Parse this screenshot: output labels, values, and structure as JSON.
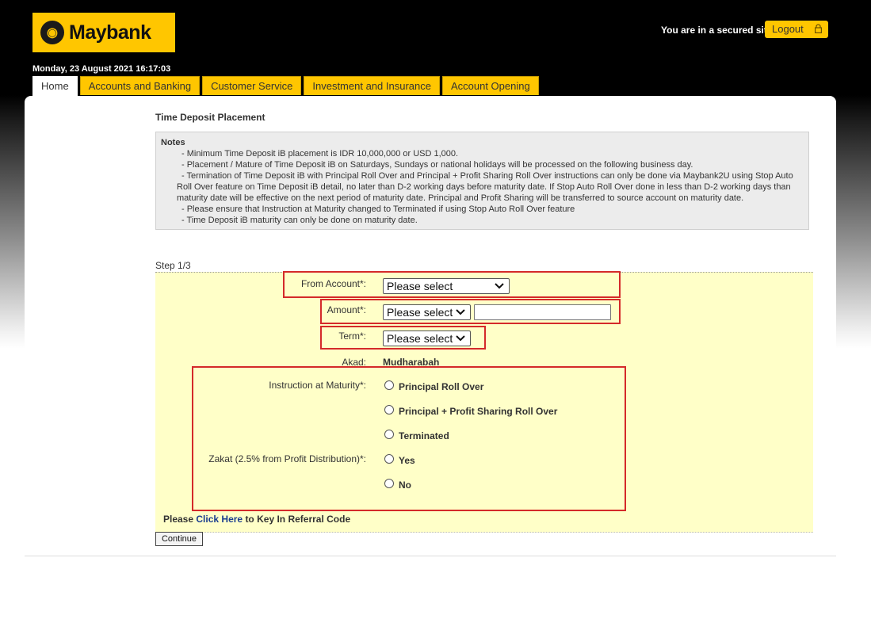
{
  "header": {
    "logo_text": "Maybank",
    "secure_text": "You are in a secured site",
    "logout_label": "Logout",
    "datetime": "Monday, 23 August 2021 16:17:03"
  },
  "tabs": [
    {
      "label": "Home",
      "active": true
    },
    {
      "label": "Accounts and Banking",
      "active": false
    },
    {
      "label": "Customer Service",
      "active": false
    },
    {
      "label": "Investment and Insurance",
      "active": false
    },
    {
      "label": "Account Opening",
      "active": false
    }
  ],
  "page": {
    "title": "Time Deposit Placement",
    "notes_title": "Notes",
    "notes": [
      "- Minimum Time Deposit iB placement is IDR 10,000,000 or USD 1,000.",
      "- Placement / Mature of Time Deposit iB on Saturdays, Sundays or national holidays will be processed on the following business day.",
      "- Termination of Time Deposit iB with Principal Roll Over and Principal + Profit Sharing Roll Over instructions can only be done via Maybank2U using Stop Auto Roll Over feature on Time Deposit iB detail, no later than D-2 working days before maturity date. If Stop Auto Roll Over done in less than D-2 working days than maturity date will be effective on the next period of maturity date. Principal and Profit Sharing will be transferred to source account on maturity date.",
      "- Please ensure that Instruction at Maturity changed to Terminated if using Stop Auto Roll Over feature",
      "- Time Deposit iB maturity can only be done on maturity date."
    ],
    "step": "Step 1/3"
  },
  "form": {
    "from_account_label": "From Account*:",
    "from_account_value": "Please select",
    "amount_label": "Amount*:",
    "amount_currency_value": "Please select",
    "amount_value": "",
    "term_label": "Term*:",
    "term_value": "Please select",
    "akad_label": "Akad:",
    "akad_value": "Mudharabah",
    "instruction_label": "Instruction at Maturity*:",
    "instruction_options": [
      "Principal Roll Over",
      "Principal + Profit Sharing Roll Over",
      "Terminated"
    ],
    "zakat_label": "Zakat (2.5% from Profit Distribution)*:",
    "zakat_options": [
      "Yes",
      "No"
    ]
  },
  "referral": {
    "prefix": "Please",
    "link": "Click Here",
    "suffix": "to Key In Referral Code"
  },
  "continue_label": "Continue",
  "colors": {
    "brand_yellow": "#ffc600",
    "form_background": "#ffffc8",
    "highlight_red": "#d42a2a",
    "link_blue": "#1a3d8f"
  }
}
